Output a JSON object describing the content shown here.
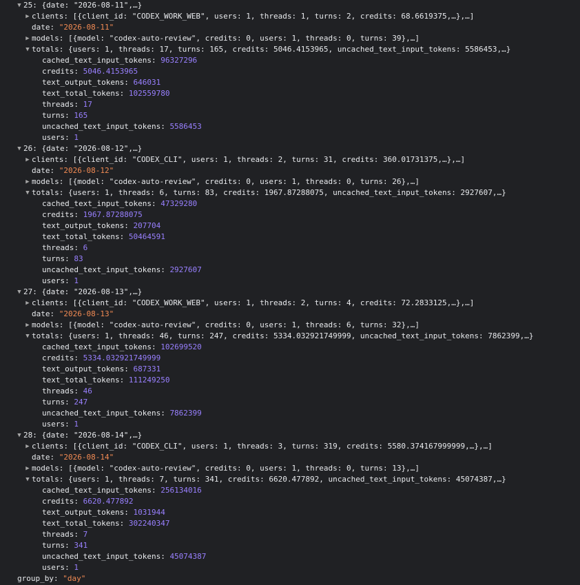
{
  "root_expanded": [
    {
      "index": "25",
      "summary": "{date: \"2026-08-11\",…}",
      "clients_summary": "[{client_id: \"CODEX_WORK_WEB\", users: 1, threads: 1, turns: 2, credits: 68.6619375,…},…]",
      "date": "\"2026-08-11\"",
      "models_summary": "[{model: \"codex-auto-review\", credits: 0, users: 1, threads: 0, turns: 39},…]",
      "totals_summary": "{users: 1, threads: 17, turns: 165, credits: 5046.4153965, uncached_text_input_tokens: 5586453,…}",
      "totals": [
        {
          "key": "cached_text_input_tokens",
          "value": "96327296"
        },
        {
          "key": "credits",
          "value": "5046.4153965"
        },
        {
          "key": "text_output_tokens",
          "value": "646031"
        },
        {
          "key": "text_total_tokens",
          "value": "102559780"
        },
        {
          "key": "threads",
          "value": "17"
        },
        {
          "key": "turns",
          "value": "165"
        },
        {
          "key": "uncached_text_input_tokens",
          "value": "5586453"
        },
        {
          "key": "users",
          "value": "1"
        }
      ]
    },
    {
      "index": "26",
      "summary": "{date: \"2026-08-12\",…}",
      "clients_summary": "[{client_id: \"CODEX_CLI\", users: 1, threads: 2, turns: 31, credits: 360.01731375,…},…]",
      "date": "\"2026-08-12\"",
      "models_summary": "[{model: \"codex-auto-review\", credits: 0, users: 1, threads: 0, turns: 26},…]",
      "totals_summary": "{users: 1, threads: 6, turns: 83, credits: 1967.87288075, uncached_text_input_tokens: 2927607,…}",
      "totals": [
        {
          "key": "cached_text_input_tokens",
          "value": "47329280"
        },
        {
          "key": "credits",
          "value": "1967.87288075"
        },
        {
          "key": "text_output_tokens",
          "value": "207704"
        },
        {
          "key": "text_total_tokens",
          "value": "50464591"
        },
        {
          "key": "threads",
          "value": "6"
        },
        {
          "key": "turns",
          "value": "83"
        },
        {
          "key": "uncached_text_input_tokens",
          "value": "2927607"
        },
        {
          "key": "users",
          "value": "1"
        }
      ]
    },
    {
      "index": "27",
      "summary": "{date: \"2026-08-13\",…}",
      "clients_summary": "[{client_id: \"CODEX_WORK_WEB\", users: 1, threads: 2, turns: 4, credits: 72.2833125,…},…]",
      "date": "\"2026-08-13\"",
      "models_summary": "[{model: \"codex-auto-review\", credits: 0, users: 1, threads: 6, turns: 32},…]",
      "totals_summary": "{users: 1, threads: 46, turns: 247, credits: 5334.032921749999, uncached_text_input_tokens: 7862399,…}",
      "totals": [
        {
          "key": "cached_text_input_tokens",
          "value": "102699520"
        },
        {
          "key": "credits",
          "value": "5334.032921749999"
        },
        {
          "key": "text_output_tokens",
          "value": "687331"
        },
        {
          "key": "text_total_tokens",
          "value": "111249250"
        },
        {
          "key": "threads",
          "value": "46"
        },
        {
          "key": "turns",
          "value": "247"
        },
        {
          "key": "uncached_text_input_tokens",
          "value": "7862399"
        },
        {
          "key": "users",
          "value": "1"
        }
      ]
    },
    {
      "index": "28",
      "summary": "{date: \"2026-08-14\",…}",
      "clients_summary": "[{client_id: \"CODEX_CLI\", users: 1, threads: 3, turns: 319, credits: 5580.374167999999,…},…]",
      "date": "\"2026-08-14\"",
      "models_summary": "[{model: \"codex-auto-review\", credits: 0, users: 1, threads: 0, turns: 13},…]",
      "totals_summary": "{users: 1, threads: 7, turns: 341, credits: 6620.477892, uncached_text_input_tokens: 45074387,…}",
      "totals": [
        {
          "key": "cached_text_input_tokens",
          "value": "256134016"
        },
        {
          "key": "credits",
          "value": "6620.477892"
        },
        {
          "key": "text_output_tokens",
          "value": "1031944"
        },
        {
          "key": "text_total_tokens",
          "value": "302240347"
        },
        {
          "key": "threads",
          "value": "7"
        },
        {
          "key": "turns",
          "value": "341"
        },
        {
          "key": "uncached_text_input_tokens",
          "value": "45074387"
        },
        {
          "key": "users",
          "value": "1"
        }
      ]
    }
  ],
  "labels": {
    "clients": "clients",
    "date": "date",
    "models": "models",
    "totals": "totals",
    "group_by": "group_by"
  },
  "group_by": "\"day\"",
  "glyphs": {
    "expanded": "▼",
    "collapsed": "▶"
  },
  "colors": {
    "background": "#202124",
    "key": "#e8eaed",
    "number": "#9980ff",
    "string": "#f28b54"
  }
}
